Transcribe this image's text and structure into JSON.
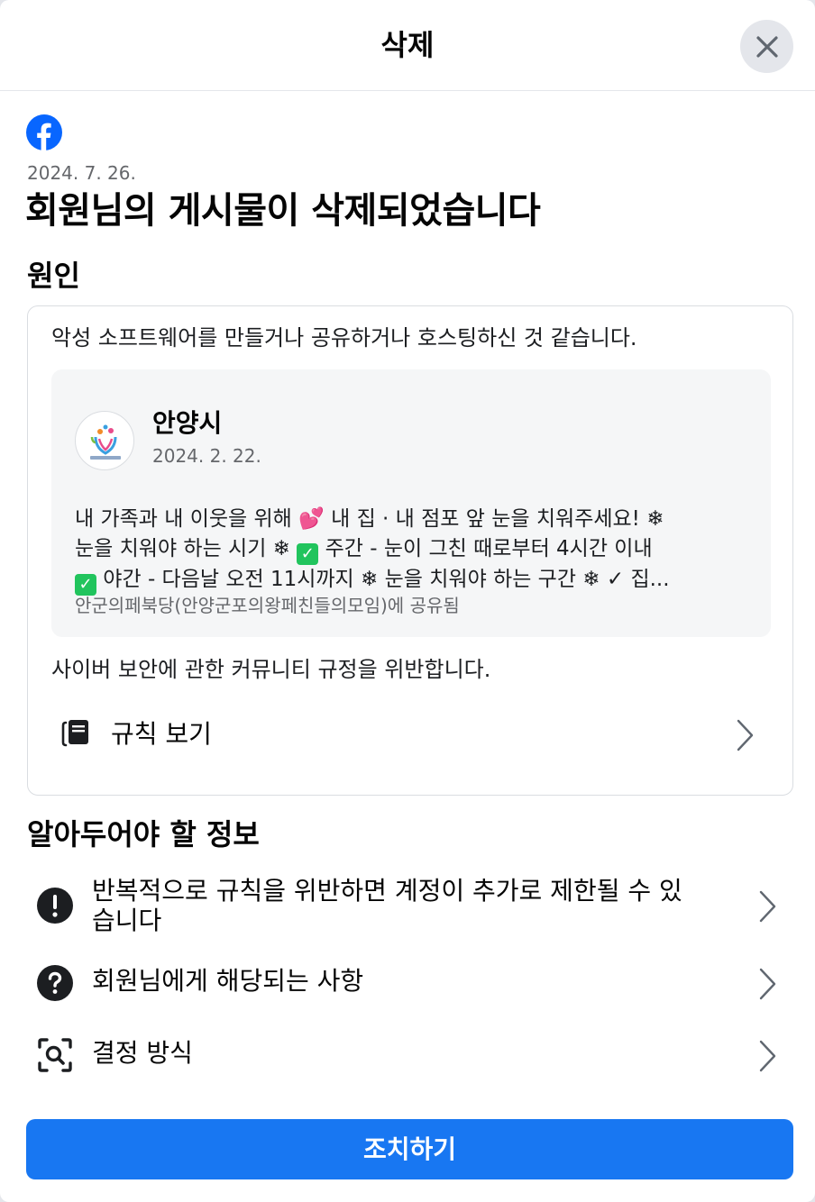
{
  "header": {
    "title": "삭제"
  },
  "notice": {
    "date": "2024. 7. 26.",
    "title": "회원님의 게시물이 삭제되었습니다"
  },
  "reason_section": {
    "title": "원인",
    "reason_text": "악성 소프트웨어를 만들거나 공유하거나 호스팅하신 것 같습니다.",
    "post": {
      "author": "안양시",
      "date": "2024. 2. 22.",
      "lines": [
        [
          "내 가족과 내 이웃을 위해 ",
          " 내 집 · 내 점포 앞 눈을 치워주세요! ❄"
        ],
        [
          "눈을 치워야 하는 시기 ❄ ",
          " 주간 - 눈이 그친 때로부터 4시간 이내"
        ],
        [
          "",
          " 야간 - 다음날 오전 11시까지 ❄ 눈을 치워야 하는 구간 ❄ ✓ 집..."
        ]
      ],
      "shared_in": "안군의페북당(안양군포의왕페친들의모임)에 공유됨"
    },
    "violation_text": "사이버 보안에 관한 커뮤니티 규정을 위반합니다.",
    "rules_link": "규칙 보기"
  },
  "info_section": {
    "title": "알아두어야 할 정보",
    "items": [
      {
        "line1": "반복적으로 규칙을 위반하면 계정이 추가로 제한될 수 있",
        "line2": "습니다",
        "icon": "exclamation-icon"
      },
      {
        "line1": "회원님에게 해당되는 사항",
        "icon": "question-icon"
      },
      {
        "line1": "결정 방식",
        "icon": "search-scan-icon"
      }
    ]
  },
  "action_button": {
    "label": "조치하기"
  },
  "colors": {
    "accent": "#1877f2",
    "secondary_text": "#65676b",
    "card_bg": "#f5f6f7"
  }
}
